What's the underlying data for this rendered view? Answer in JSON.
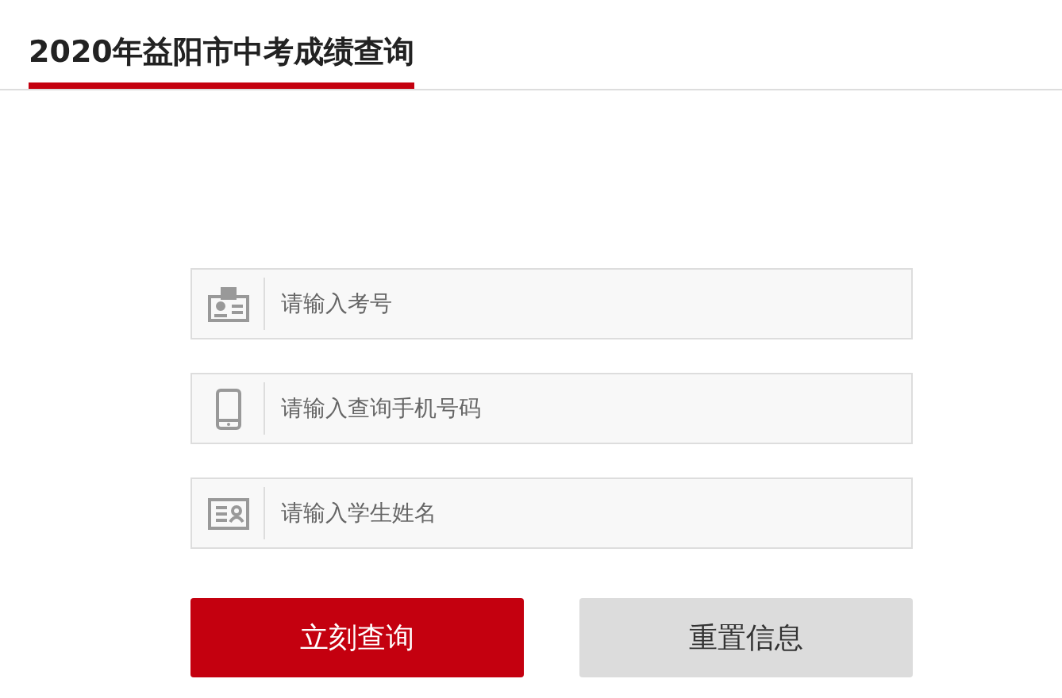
{
  "title": "2020年益阳市中考成绩查询",
  "fields": [
    {
      "kind": "badge",
      "placeholder": "请输入考号"
    },
    {
      "kind": "phone",
      "placeholder": "请输入查询手机号码"
    },
    {
      "kind": "card",
      "placeholder": "请输入学生姓名"
    }
  ],
  "buttons": [
    {
      "kind": "primary",
      "label": "立刻查询"
    },
    {
      "kind": "secondary",
      "label": "重置信息"
    }
  ]
}
